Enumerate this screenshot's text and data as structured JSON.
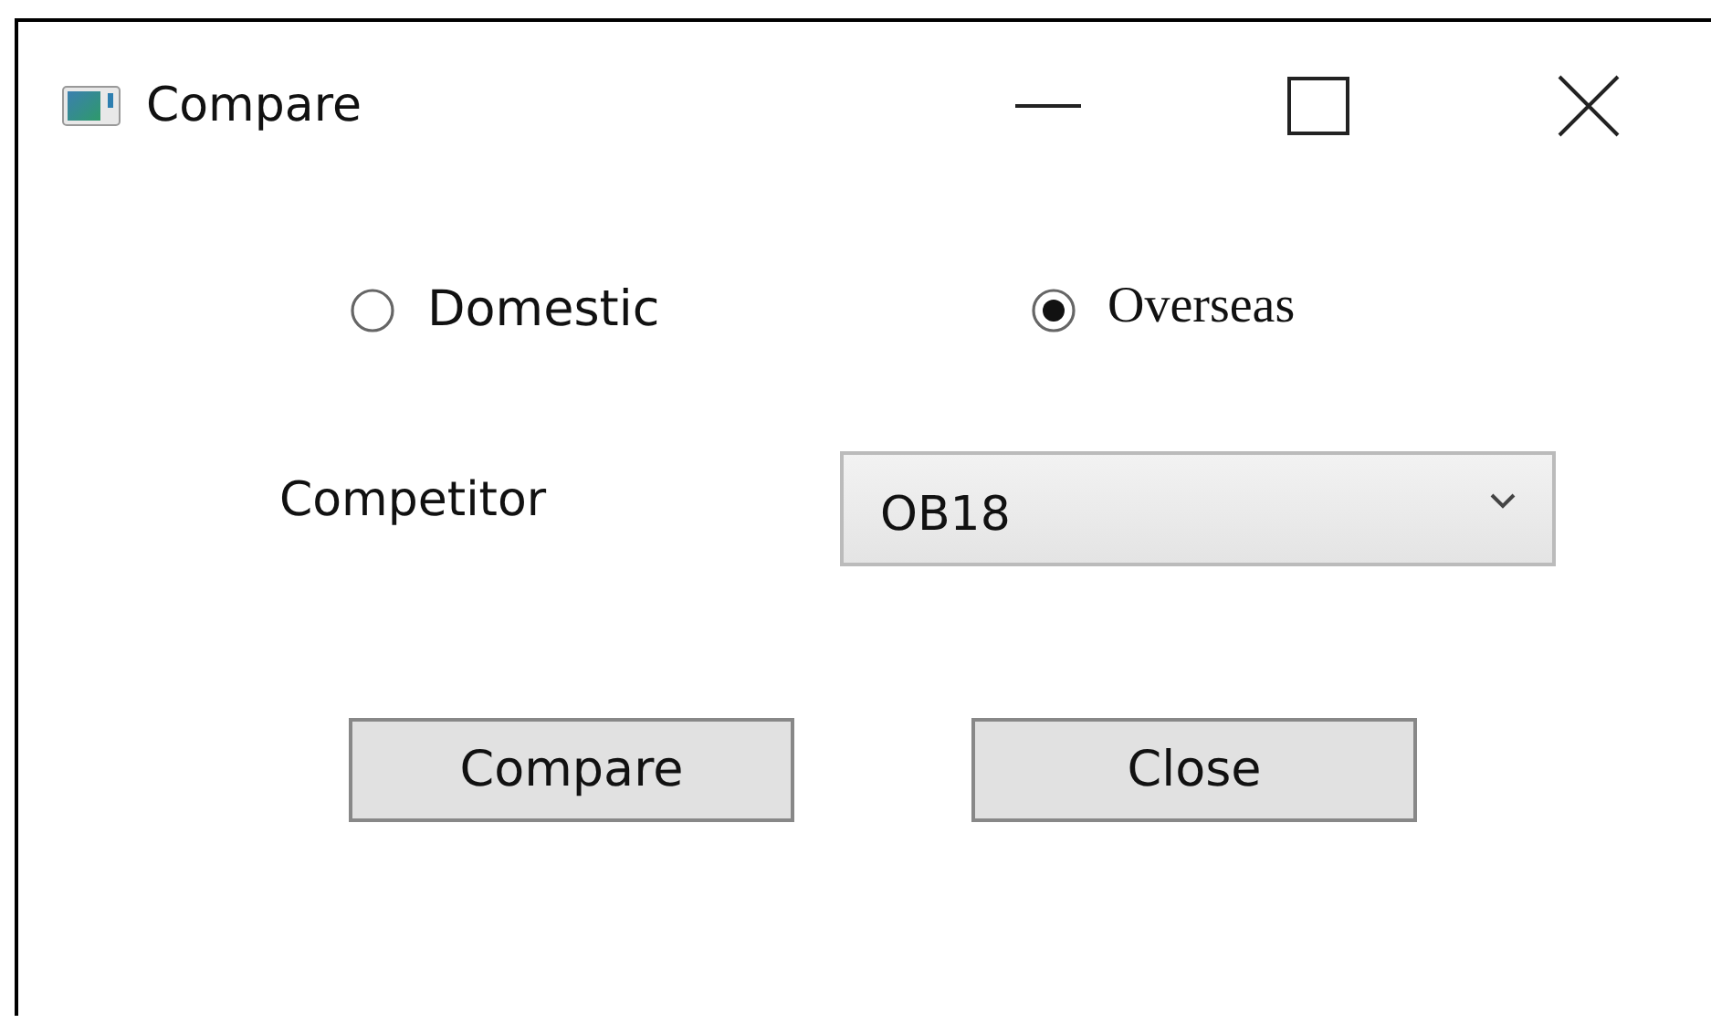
{
  "window": {
    "title": "Compare"
  },
  "origin": [
    {
      "label": "Domestic",
      "selected": false,
      "kind": "sans"
    },
    {
      "label": "Overseas",
      "selected": true,
      "kind": "serif"
    }
  ],
  "competitor": {
    "label": "Competitor",
    "value": "OB18"
  },
  "buttons": [
    "Compare",
    "Close"
  ]
}
